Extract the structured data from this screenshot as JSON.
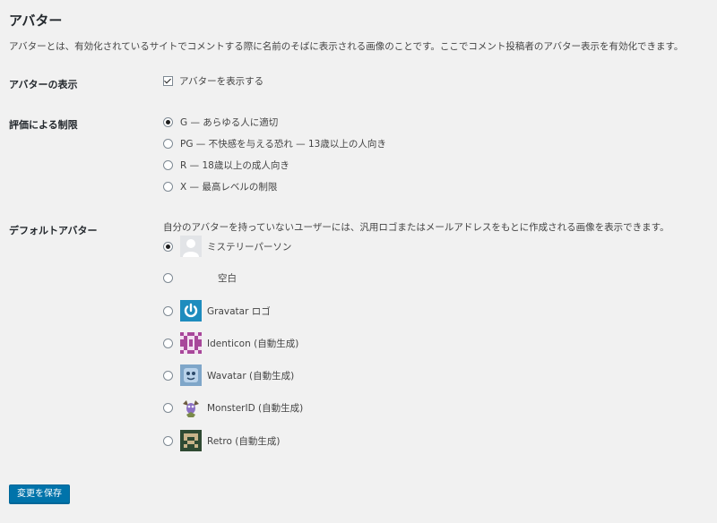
{
  "section": {
    "title": "アバター",
    "description": "アバターとは、有効化されているサイトでコメントする際に名前のそばに表示される画像のことです。ここでコメント投稿者のアバター表示を有効化できます。"
  },
  "show_avatars": {
    "label": "アバターの表示",
    "checkbox_label": "アバターを表示する",
    "checked": true
  },
  "rating": {
    "label": "評価による制限",
    "options": [
      {
        "label": "G — あらゆる人に適切",
        "checked": true
      },
      {
        "label": "PG — 不快感を与える恐れ — 13歳以上の人向き",
        "checked": false
      },
      {
        "label": "R — 18歳以上の成人向き",
        "checked": false
      },
      {
        "label": "X — 最高レベルの制限",
        "checked": false
      }
    ]
  },
  "default_avatar": {
    "label": "デフォルトアバター",
    "description": "自分のアバターを持っていないユーザーには、汎用ロゴまたはメールアドレスをもとに作成される画像を表示できます。",
    "options": [
      {
        "label": "ミステリーパーソン",
        "icon": "mystery-person-icon",
        "checked": true
      },
      {
        "label": "空白",
        "icon": "blank-icon",
        "checked": false
      },
      {
        "label": "Gravatar ロゴ",
        "icon": "gravatar-logo-icon",
        "checked": false
      },
      {
        "label": "Identicon (自動生成)",
        "icon": "identicon-icon",
        "checked": false
      },
      {
        "label": "Wavatar (自動生成)",
        "icon": "wavatar-icon",
        "checked": false
      },
      {
        "label": "MonsterID (自動生成)",
        "icon": "monsterid-icon",
        "checked": false
      },
      {
        "label": "Retro (自動生成)",
        "icon": "retro-icon",
        "checked": false
      }
    ]
  },
  "save_button": {
    "label": "変更を保存"
  },
  "colors": {
    "background": "#f1f1f1",
    "primary_button": "#0073aa",
    "gravatar_blue": "#1e8cbe",
    "identicon_magenta": "#a8479a"
  }
}
